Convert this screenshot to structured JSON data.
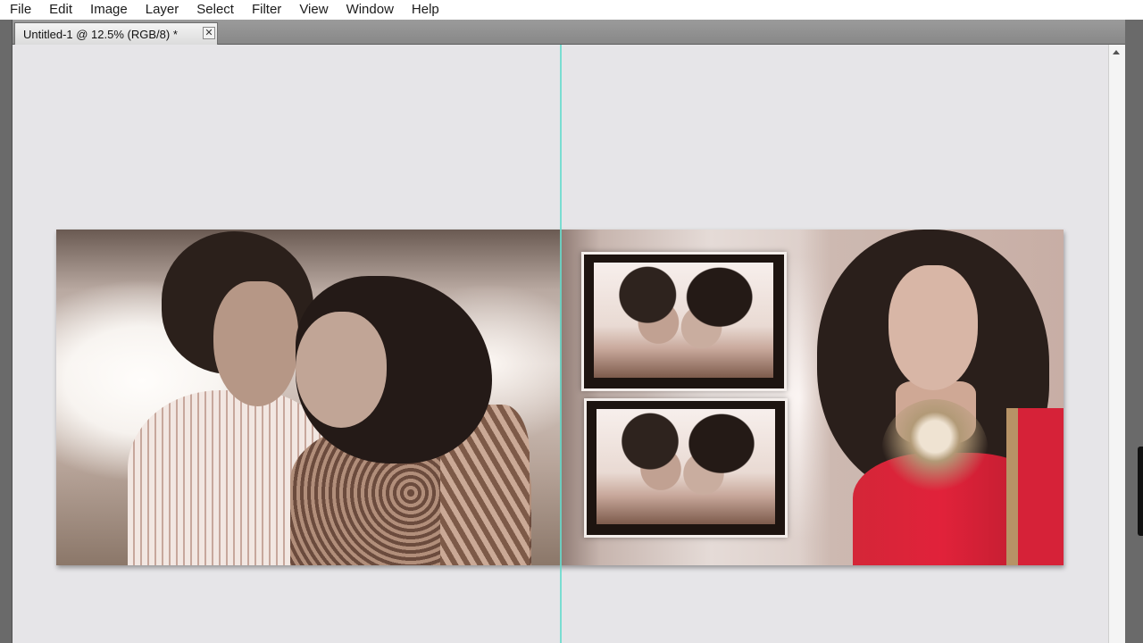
{
  "menu": {
    "items": [
      "File",
      "Edit",
      "Image",
      "Layer",
      "Select",
      "Filter",
      "View",
      "Window",
      "Help"
    ]
  },
  "document": {
    "tab_title": "Untitled-1 @ 12.5% (RGB/8) *",
    "close_glyph": "✕"
  },
  "icons": {
    "tab_close": "close-icon",
    "scroll_up": "chevron-up-icon"
  },
  "colors": {
    "guide": "#66dccd",
    "menubar": "#ffffff",
    "pasteboard": "#e6e5e8",
    "chrome": "#6a6a6a",
    "dress_red": "#d42638"
  }
}
